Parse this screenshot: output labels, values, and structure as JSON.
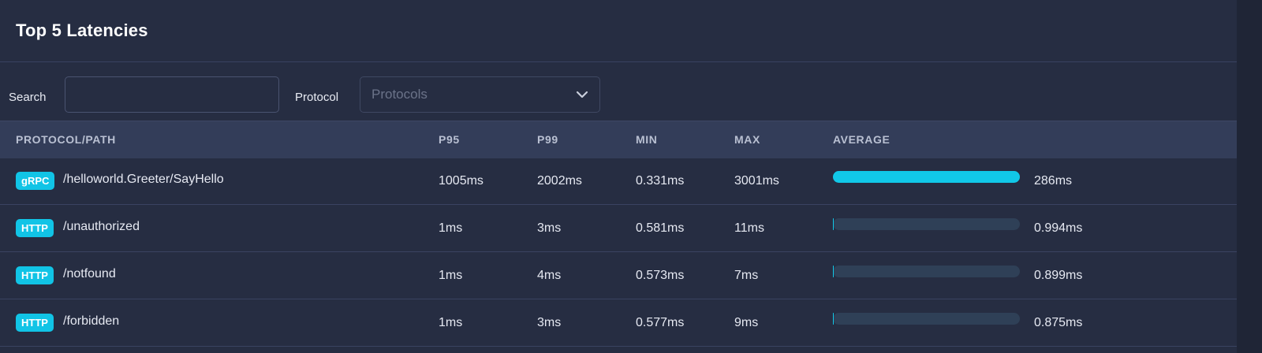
{
  "panel": {
    "title": "Top 5 Latencies"
  },
  "filters": {
    "search_label": "Search",
    "search_value": "",
    "search_placeholder": "",
    "protocol_label": "Protocol",
    "protocol_placeholder": "Protocols"
  },
  "table": {
    "columns": {
      "path": "PROTOCOL/PATH",
      "p95": "P95",
      "p99": "P99",
      "min": "MIN",
      "max": "MAX",
      "average": "AVERAGE"
    },
    "rows": [
      {
        "protocol": "gRPC",
        "path": "/helloworld.Greeter/SayHello",
        "p95": "1005ms",
        "p99": "2002ms",
        "min": "0.331ms",
        "max": "3001ms",
        "average": "286ms",
        "average_fraction": 1.0
      },
      {
        "protocol": "HTTP",
        "path": "/unauthorized",
        "p95": "1ms",
        "p99": "3ms",
        "min": "0.581ms",
        "max": "11ms",
        "average": "0.994ms",
        "average_fraction": 0.003
      },
      {
        "protocol": "HTTP",
        "path": "/notfound",
        "p95": "1ms",
        "p99": "4ms",
        "min": "0.573ms",
        "max": "7ms",
        "average": "0.899ms",
        "average_fraction": 0.003
      },
      {
        "protocol": "HTTP",
        "path": "/forbidden",
        "p95": "1ms",
        "p99": "3ms",
        "min": "0.577ms",
        "max": "9ms",
        "average": "0.875ms",
        "average_fraction": 0.003
      }
    ]
  },
  "colors": {
    "background": "#262d42",
    "header_row": "#333d59",
    "badge": "#11c4e6",
    "bar_fill": "#11c8e8",
    "bar_track": "#2f4057"
  },
  "icons": {
    "protocol_dropdown": "chevron-down-icon"
  }
}
